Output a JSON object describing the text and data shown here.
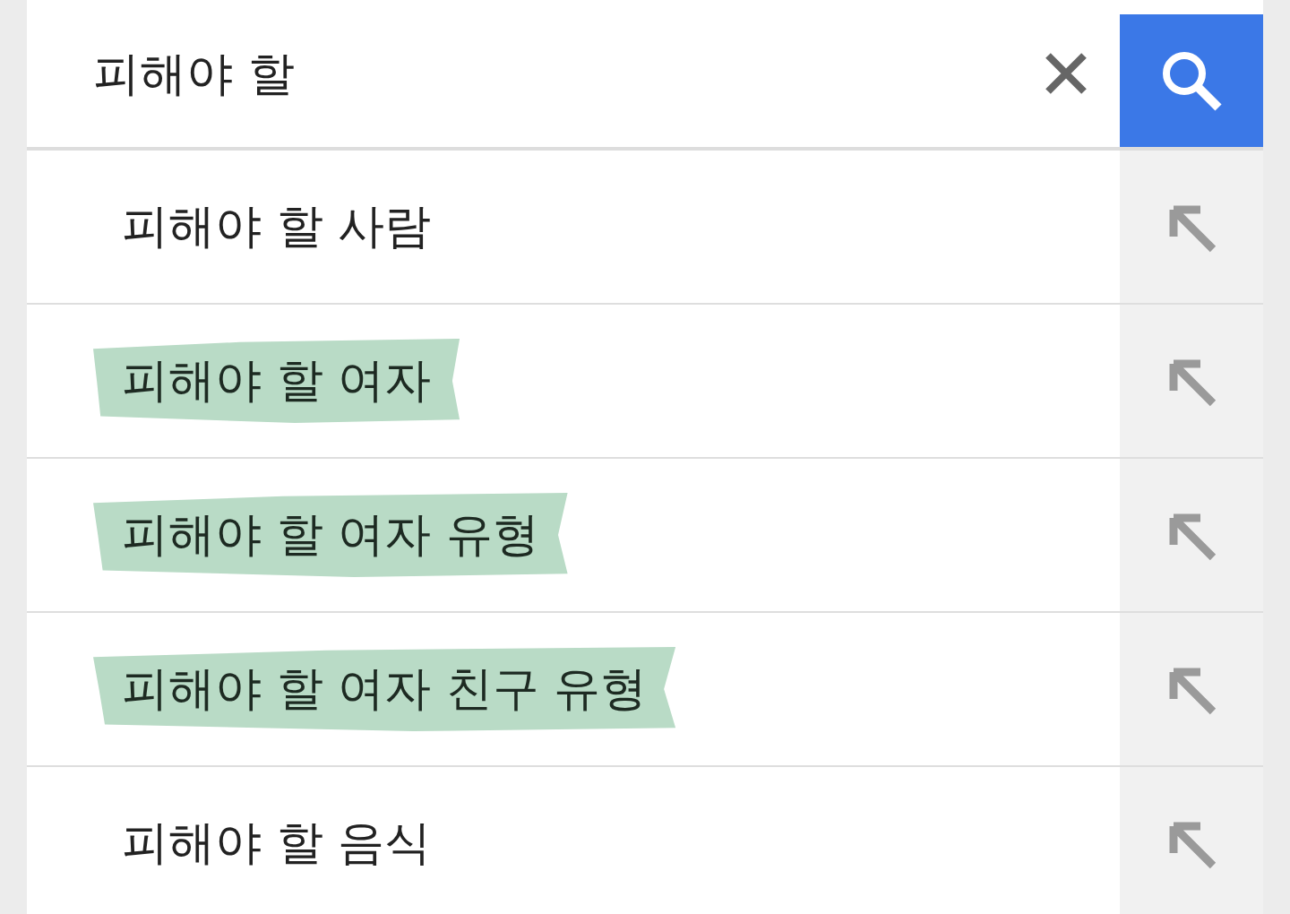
{
  "search": {
    "value": "피해야 할"
  },
  "suggestions": [
    {
      "text": "피해야 할 사람",
      "highlighted": false
    },
    {
      "text": "피해야 할 여자",
      "highlighted": true
    },
    {
      "text": "피해야 할 여자 유형",
      "highlighted": true
    },
    {
      "text": "피해야 할 여자 친구 유형",
      "highlighted": true
    },
    {
      "text": "피해야 할 음식",
      "highlighted": false
    }
  ]
}
